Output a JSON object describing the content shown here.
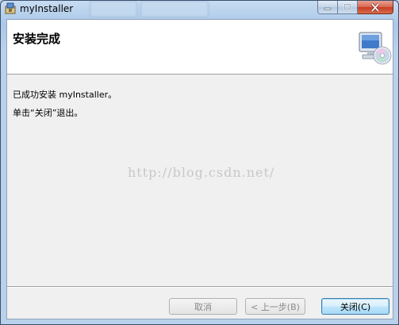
{
  "window": {
    "title": "myInstaller",
    "app_icon": "installer-icon",
    "controls": {
      "minimize": "—",
      "maximize": "□",
      "close": "✕"
    }
  },
  "banner": {
    "title": "安装完成",
    "icon": "computer-cd-icon"
  },
  "content": {
    "line1": "已成功安装 myInstaller。",
    "line2": "单击“关闭”退出。",
    "watermark": "http://blog.csdn.net/"
  },
  "buttons": {
    "cancel": "取消",
    "back": "< 上一步(B)",
    "close": "关闭(C)"
  },
  "colors": {
    "client_bg": "#f0f0f0",
    "banner_bg": "#ffffff",
    "close_btn": "#c63d22",
    "default_btn_border": "#3c7fb1"
  }
}
